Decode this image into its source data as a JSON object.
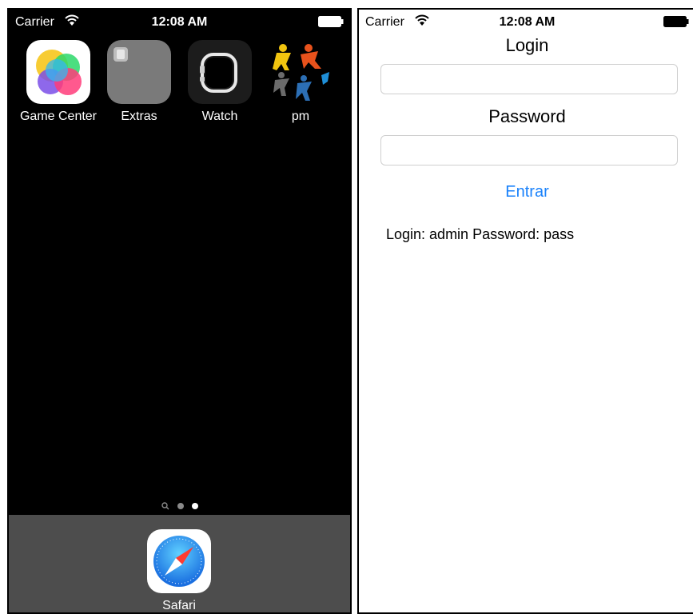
{
  "left_screen": {
    "status_bar": {
      "carrier": "Carrier",
      "time": "12:08 AM"
    },
    "apps": [
      {
        "label": "Game Center",
        "icon": "game-center-icon"
      },
      {
        "label": "Extras",
        "icon": "folder-icon"
      },
      {
        "label": "Watch",
        "icon": "watch-icon"
      },
      {
        "label": "pm",
        "icon": "sports-players-icon"
      }
    ],
    "page_indicator": {
      "pages": 2,
      "current": 2
    },
    "dock": {
      "apps": [
        {
          "label": "Safari",
          "icon": "safari-compass-icon"
        }
      ]
    }
  },
  "right_screen": {
    "status_bar": {
      "carrier": "Carrier",
      "time": "12:08 AM"
    },
    "login_label": "Login",
    "login_value": "",
    "password_label": "Password",
    "password_value": "",
    "submit_label": "Entrar",
    "hint": "Login: admin Password: pass"
  },
  "colors": {
    "ios_blue": "#1a82fb",
    "home_background": "#000000",
    "dock_background": "#4d4d4d"
  }
}
